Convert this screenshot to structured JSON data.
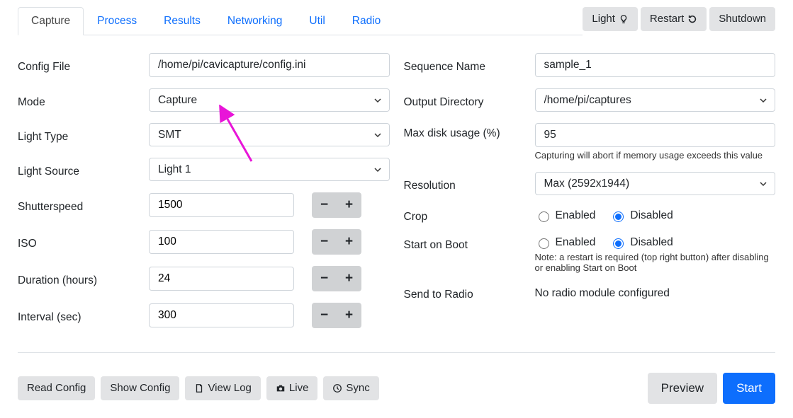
{
  "tabs": [
    "Capture",
    "Process",
    "Results",
    "Networking",
    "Util",
    "Radio"
  ],
  "active_tab": "Capture",
  "header_buttons": {
    "light": "Light",
    "restart": "Restart",
    "shutdown": "Shutdown"
  },
  "left": {
    "config_file": {
      "label": "Config File",
      "value": "/home/pi/cavicapture/config.ini"
    },
    "mode": {
      "label": "Mode",
      "value": "Capture"
    },
    "light_type": {
      "label": "Light Type",
      "value": "SMT"
    },
    "light_source": {
      "label": "Light Source",
      "value": "Light 1"
    },
    "shutterspeed": {
      "label": "Shutterspeed",
      "value": "1500"
    },
    "iso": {
      "label": "ISO",
      "value": "100"
    },
    "duration": {
      "label": "Duration (hours)",
      "value": "24"
    },
    "interval": {
      "label": "Interval (sec)",
      "value": "300"
    }
  },
  "right": {
    "sequence_name": {
      "label": "Sequence Name",
      "value": "sample_1"
    },
    "output_dir": {
      "label": "Output Directory",
      "value": "/home/pi/captures"
    },
    "max_disk": {
      "label": "Max disk usage (%)",
      "value": "95",
      "help": "Capturing will abort if memory usage exceeds this value"
    },
    "resolution": {
      "label": "Resolution",
      "value": "Max (2592x1944)"
    },
    "crop": {
      "label": "Crop",
      "enabled": "Enabled",
      "disabled": "Disabled",
      "value": "Disabled"
    },
    "start_on_boot": {
      "label": "Start on Boot",
      "enabled": "Enabled",
      "disabled": "Disabled",
      "value": "Disabled",
      "help": "Note: a restart is required (top right button) after disabling or enabling Start on Boot"
    },
    "send_radio": {
      "label": "Send to Radio",
      "text": "No radio module configured"
    }
  },
  "footer": {
    "read_config": "Read Config",
    "show_config": "Show Config",
    "view_log": "View Log",
    "live": "Live",
    "sync": "Sync",
    "preview": "Preview",
    "start": "Start"
  },
  "glyph": {
    "minus": "−",
    "plus": "+"
  }
}
